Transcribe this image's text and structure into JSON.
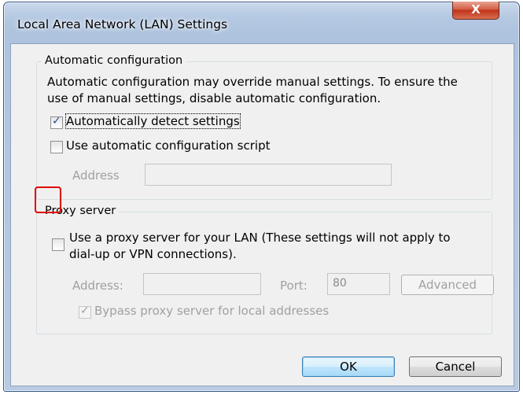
{
  "window": {
    "title": "Local Area Network (LAN) Settings",
    "close_label": "X"
  },
  "auto_config": {
    "group_label": "Automatic configuration",
    "description_line1": "Automatic configuration may override manual settings.  To ensure the",
    "description_line2": "use of manual settings, disable automatic configuration.",
    "detect_settings": {
      "label": "Automatically detect settings",
      "checked": true
    },
    "use_script": {
      "label": "Use automatic configuration script",
      "checked": false
    },
    "address_label": "Address",
    "address_value": ""
  },
  "proxy": {
    "group_label": "Proxy server",
    "use_proxy_line1": "Use a proxy server for your LAN (These settings will not apply to",
    "use_proxy_line2": "dial-up or VPN connections).",
    "use_proxy_checked": false,
    "address_label": "Address:",
    "address_value": "",
    "port_label": "Port:",
    "port_value": "80",
    "advanced_label": "Advanced",
    "bypass": {
      "label": "Bypass proxy server for local addresses",
      "checked": true
    }
  },
  "buttons": {
    "ok": "OK",
    "cancel": "Cancel"
  },
  "colors": {
    "highlight": "#e00000",
    "title_bar": "#b4c8e2",
    "client_bg": "#f0f0f0"
  }
}
